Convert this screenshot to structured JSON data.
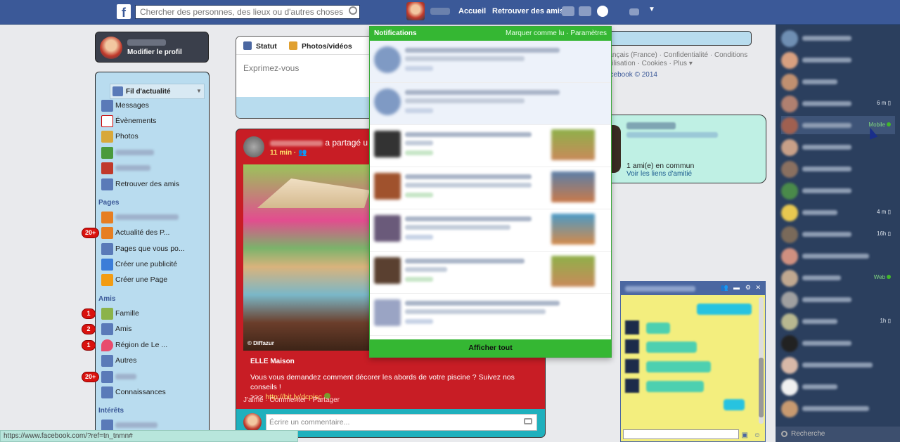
{
  "topbar": {
    "search_placeholder": "Chercher des personnes, des lieux ou d'autres choses",
    "home": "Accueil",
    "find_friends": "Retrouver des amis"
  },
  "profile": {
    "edit": "Modifier le profil"
  },
  "nav": {
    "feed": "Fil d'actualité",
    "items": [
      {
        "label": "Messages",
        "badge": ""
      },
      {
        "label": "Évènements",
        "badge": ""
      },
      {
        "label": "Photos",
        "badge": ""
      }
    ],
    "find_friends": "Retrouver des amis",
    "pages_header": "Pages",
    "pages": [
      {
        "label": "Actualité des P...",
        "badge": "20+"
      },
      {
        "label": "Pages que vous po...",
        "badge": ""
      },
      {
        "label": "Créer une publicité",
        "badge": ""
      },
      {
        "label": "Créer une Page",
        "badge": ""
      }
    ],
    "friends_header": "Amis",
    "friends": [
      {
        "label": "Famille",
        "badge": "1"
      },
      {
        "label": "Amis",
        "badge": "2"
      },
      {
        "label": "Région de Le ...",
        "badge": "1"
      },
      {
        "label": "Autres",
        "badge": ""
      },
      {
        "label": "",
        "badge": "20+"
      },
      {
        "label": "Connaissances",
        "badge": ""
      }
    ],
    "interests_header": "Intérêts"
  },
  "composer": {
    "tab_status": "Statut",
    "tab_photos": "Photos/vidéos",
    "placeholder": "Exprimez-vous"
  },
  "post": {
    "action": "a partagé u",
    "time": "11 min ·",
    "photo_credit": "© Diffazur",
    "site": "ELLE Maison",
    "text": "Vous vous demandez comment décorer les abords de votre piscine ? Suivez nos conseils !",
    "link_prefix": ">>>",
    "link": "http://bit.ly/dcpisc",
    "like": "J'aime",
    "comment": "Commenter",
    "share": "Partager",
    "comment_placeholder": "Écrire un commentaire..."
  },
  "footer": {
    "line1": "rançais (France) · Confidentialité · Conditions",
    "line2": "utilisation · Cookies · Plus",
    "copyright": "acebook © 2014"
  },
  "hovercard": {
    "mutual": "1 ami(e) en commun",
    "links": "Voir les liens d'amitié"
  },
  "notifications": {
    "title": "Notifications",
    "mark_read": "Marquer comme lu",
    "sep": "·",
    "settings": "Paramètres",
    "show_all": "Afficher tout"
  },
  "chat": {
    "statuses": [
      "6 m",
      "Mobile",
      "4 m",
      "16h",
      "Web",
      "1h"
    ],
    "search": "Recherche"
  },
  "statusbar": {
    "url": "https://www.facebook.com/?ref=tn_tnmn#"
  },
  "colors": {
    "brand": "#3b5998",
    "notif_green": "#35b733",
    "post_red": "#c81d25"
  }
}
